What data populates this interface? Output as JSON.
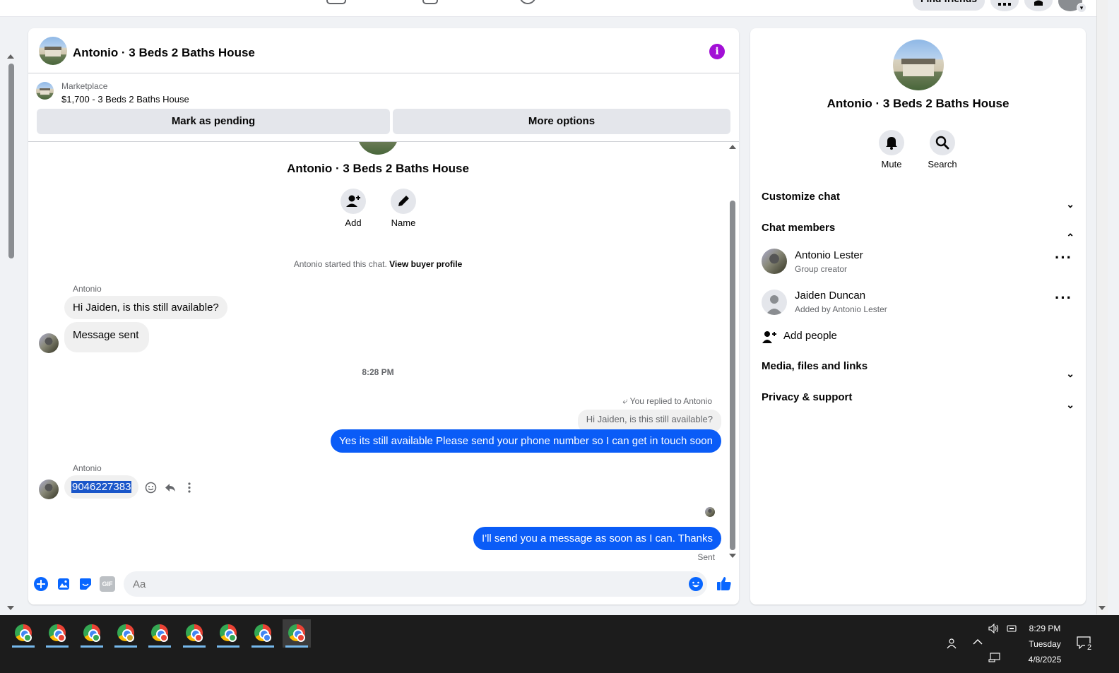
{
  "topbar": {
    "find_friends": "Find friends"
  },
  "chat": {
    "title": "Antonio · 3 Beds 2 Baths House",
    "marketplace_label": "Marketplace",
    "marketplace_price": "$1,700 - 3 Beds 2 Baths House",
    "mark_pending": "Mark as pending",
    "more_options": "More options",
    "conv_title": "Antonio · 3 Beds 2 Baths House",
    "add_label": "Add",
    "name_label": "Name",
    "started_text": "Antonio started this chat.",
    "view_profile": "View buyer profile",
    "sender_name": "Antonio",
    "msg1": "Hi Jaiden, is this still available?",
    "msg2": "Message sent",
    "timestamp": "8:28 PM",
    "replied_to": "You replied to Antonio",
    "quoted": "Hi Jaiden, is this still available?",
    "reply_msg": "Yes its still available Please send your phone number so I can get in touch soon",
    "sender_name2": "Antonio",
    "phone_msg": "9046227383",
    "last_msg": "I'll send you a message as soon as I can. Thanks",
    "sent_status": "Sent",
    "composer_placeholder": "Aa",
    "gif_label": "GIF"
  },
  "info": {
    "title": "Antonio · 3 Beds 2 Baths House",
    "mute": "Mute",
    "search": "Search",
    "customize_chat": "Customize chat",
    "chat_members": "Chat members",
    "members": [
      {
        "name": "Antonio Lester",
        "sub": "Group creator"
      },
      {
        "name": "Jaiden Duncan",
        "sub": "Added by Antonio Lester"
      }
    ],
    "add_people": "Add people",
    "media": "Media, files and links",
    "privacy": "Privacy & support"
  },
  "taskbar": {
    "time": "8:29 PM",
    "day": "Tuesday",
    "date": "4/8/2025",
    "notif_count": "2"
  },
  "colors": {
    "accent_blue": "#0a5cf7",
    "info_purple": "#a20fd6",
    "like_blue": "#0866ff"
  }
}
